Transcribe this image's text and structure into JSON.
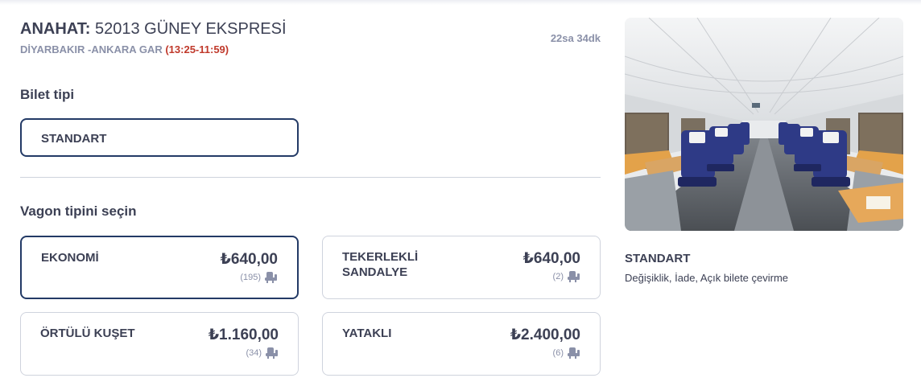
{
  "header": {
    "train_prefix": "ANAHAT:",
    "train_name": "52013 GÜNEY EKSPRESİ",
    "route": "DİYARBAKIR -ANKARA GAR",
    "time": "(13:25-11:59)",
    "duration": "22sa 34dk"
  },
  "ticket": {
    "label": "Bilet tipi",
    "selected": "STANDART"
  },
  "wagon": {
    "label": "Vagon tipini seçin",
    "options": [
      {
        "name": "EKONOMİ",
        "price": "₺640,00",
        "count": "(195)"
      },
      {
        "name": "TEKERLEKLİ SANDALYE",
        "price": "₺640,00",
        "count": "(2)"
      },
      {
        "name": "ÖRTÜLÜ KUŞET",
        "price": "₺1.160,00",
        "count": "(34)"
      },
      {
        "name": "YATAKLI",
        "price": "₺2.400,00",
        "count": "(6)"
      }
    ]
  },
  "info": {
    "title": "STANDART",
    "description": "Değişiklik, İade, Açık bilete çevirme"
  },
  "icons": {
    "seat": "seat-icon",
    "photo": "train-interior-photo"
  },
  "colors": {
    "accent": "#233a66",
    "text": "#3c4054",
    "muted": "#8a90a8",
    "time": "#c0392b",
    "seat_fabric": "#2e3a86"
  }
}
